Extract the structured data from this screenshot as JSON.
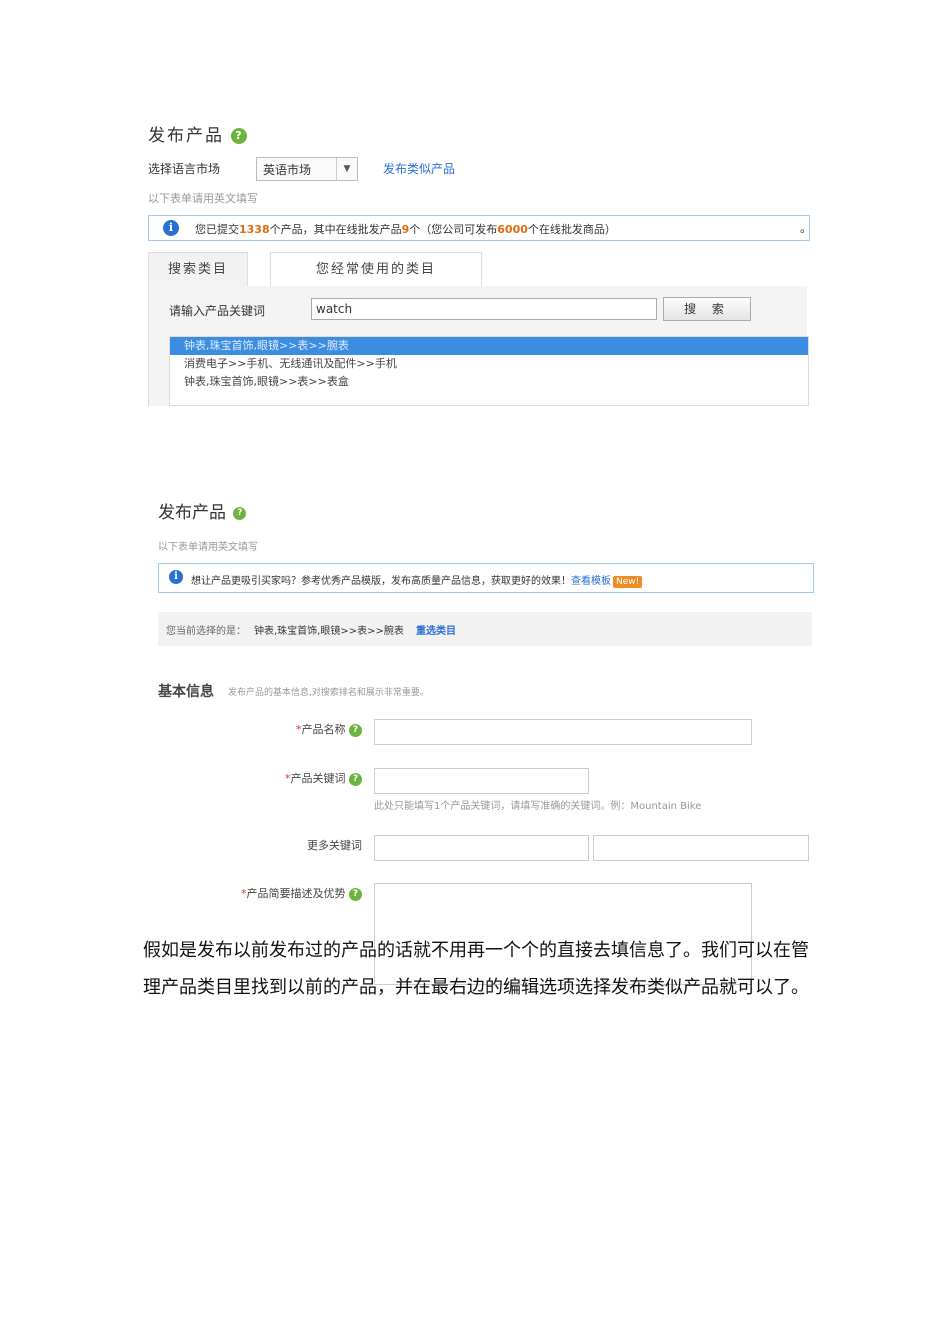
{
  "panel1": {
    "title": "发布产品",
    "help_icon": "question-icon",
    "language_label": "选择语言市场",
    "language_value": "英语市场",
    "similar_link": "发布类似产品",
    "hint": "以下表单请用英文填写",
    "notice": {
      "part1": "您已提交",
      "count_total": "1338",
      "part2": "个产品，其中在线批发产品",
      "count_wholesale": "9",
      "part3": "个（您公司可发布",
      "count_limit": "6000",
      "part4": "个在线批发商品）",
      "trailing": "。"
    },
    "tabs": [
      {
        "label": "搜索类目"
      },
      {
        "label": "您经常使用的类目"
      }
    ],
    "keyword_label": "请输入产品关键词",
    "keyword_value": "watch",
    "search_button": "搜 索",
    "results": [
      "钟表,珠宝首饰,眼镜>>表>>腕表",
      "消费电子>>手机、无线通讯及配件>>手机",
      "钟表,珠宝首饰,眼镜>>表>>表盒"
    ]
  },
  "panel2": {
    "title": "发布产品",
    "hint": "以下表单请用英文填写",
    "notice_text": "想让产品更吸引买家吗？参考优秀产品模版，发布高质量产品信息，获取更好的效果！",
    "notice_link": "查看模板",
    "new_badge": "New!",
    "current_label": "您当前选择的是：",
    "current_value": "钟表,珠宝首饰,眼镜>>表>>腕表",
    "reselect_link": "重选类目",
    "section_title": "基本信息",
    "section_sub": "发布产品的基本信息,对搜索排名和展示非常重要。",
    "fields": {
      "name_label": "产品名称",
      "keyword_label": "产品关键词",
      "keyword_hint": "此处只能填写1个产品关键词，请填写准确的关键词。例：Mountain Bike",
      "more_label": "更多关键词",
      "desc_label": "产品简要描述及优势"
    },
    "required_mark": "*"
  },
  "paragraph": "假如是发布以前发布过的产品的话就不用再一个个的直接去填信息了。我们可以在管理产品类目里找到以前的产品，并在最右边的编辑选项选择发布类似产品就可以了。"
}
